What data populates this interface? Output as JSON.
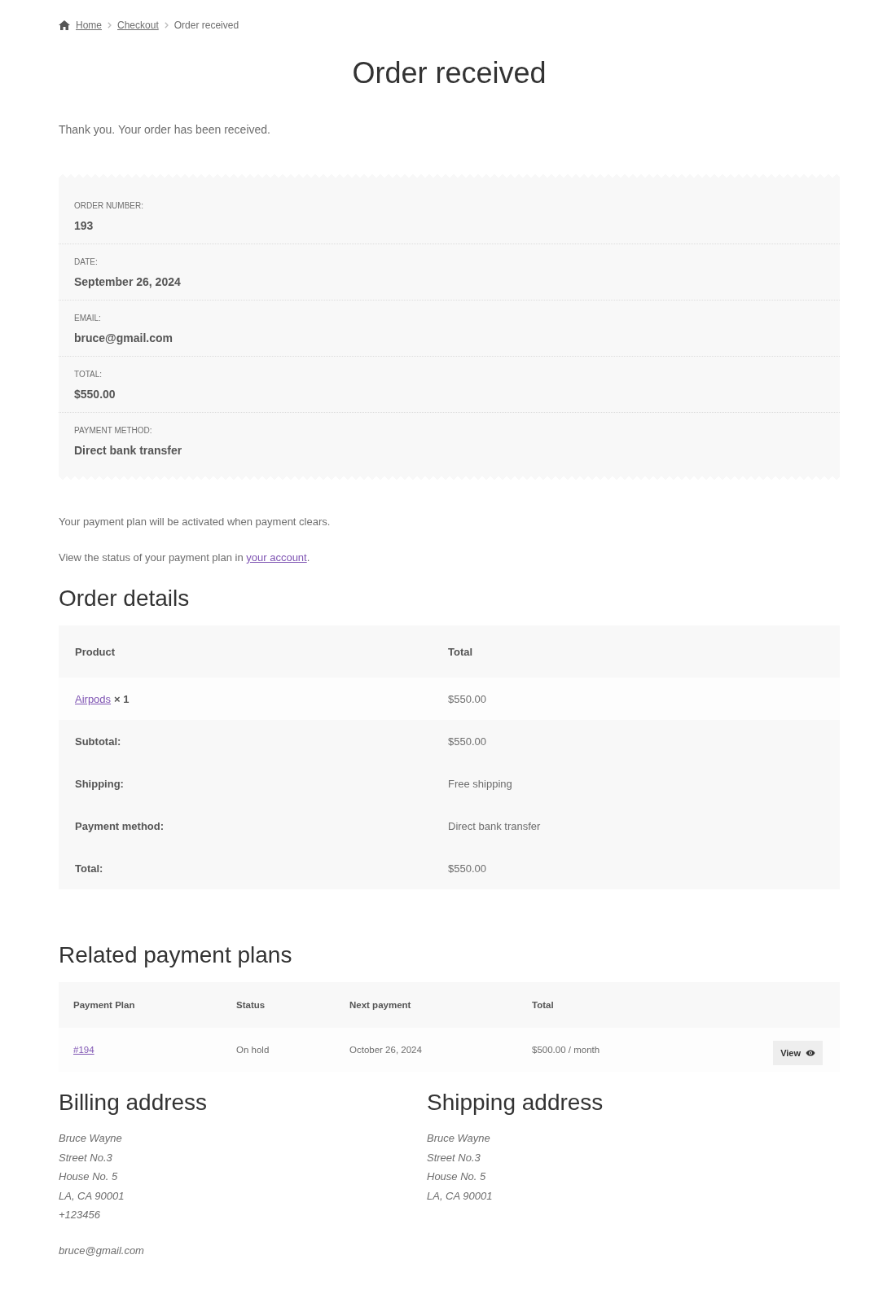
{
  "breadcrumb": [
    {
      "label": "Home",
      "kind": "link"
    },
    {
      "label": "Checkout",
      "kind": "link"
    },
    {
      "label": "Order received",
      "kind": "current"
    }
  ],
  "page_title": "Order received",
  "notice": "Thank you. Your order has been received.",
  "order_overview": [
    {
      "label": "ORDER NUMBER:",
      "value": "193"
    },
    {
      "label": "DATE:",
      "value": "September 26, 2024"
    },
    {
      "label": "EMAIL:",
      "value": "bruce@gmail.com"
    },
    {
      "label": "TOTAL:",
      "value": "$550.00"
    },
    {
      "label": "PAYMENT METHOD:",
      "value": "Direct bank transfer"
    }
  ],
  "activation_note": "Your payment plan will be activated when payment clears.",
  "account_note": {
    "text": "View the status of your payment plan in ",
    "link": "your account",
    "after": "."
  },
  "order_details": {
    "title": "Order details",
    "columns": [
      "Product",
      "Total"
    ],
    "items": [
      {
        "product": "Airpods",
        "quantity": "× 1",
        "total": "$550.00"
      }
    ],
    "totals": [
      {
        "label": "Subtotal:",
        "value": "$550.00"
      },
      {
        "label": "Shipping:",
        "value": "Free shipping"
      },
      {
        "label": "Payment method:",
        "value": "Direct bank transfer"
      },
      {
        "label": "Total:",
        "value": "$550.00"
      }
    ]
  },
  "related_payment_plans": {
    "title": "Related payment plans",
    "columns": [
      "Payment Plan",
      "Status",
      "Next payment",
      "Total"
    ],
    "rows": [
      {
        "plan": "#194",
        "status": "On hold",
        "next_payment": "October 26, 2024",
        "total": "$500.00 / month",
        "action": "View"
      }
    ]
  },
  "billing_address": {
    "title": "Billing address",
    "lines": [
      "Bruce Wayne",
      "Street No.3",
      "House No. 5",
      "LA, CA 90001",
      "+123456"
    ],
    "email": "bruce@gmail.com"
  },
  "shipping_address": {
    "title": "Shipping address",
    "lines": [
      "Bruce Wayne",
      "Street No.3",
      "House No. 5",
      "LA, CA 90001"
    ]
  }
}
